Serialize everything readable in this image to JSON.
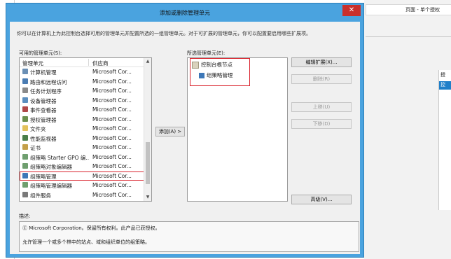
{
  "background": {
    "right_title": "页面 - 单个授权",
    "right_pane_header": "授",
    "right_pane_row": "控"
  },
  "dialog": {
    "title": "添加或删除管理单元",
    "close_glyph": "✕",
    "description": "你可以在计算机上为此控制台选择可用的管理单元并配置所选的一组管理单元。对于可扩展的管理单元，你可以配置要启用哪些扩展项。",
    "available_label": "可用的管理单元(S):",
    "selected_label": "所选管理单元(E):",
    "columns": {
      "name": "管理单元",
      "vendor": "供应商"
    },
    "snapins": [
      {
        "name": "计算机管理",
        "vendor": "Microsoft Cor...",
        "icon": "#6a8fb5"
      },
      {
        "name": "路由和远程访问",
        "vendor": "Microsoft Cor...",
        "icon": "#4b7db3"
      },
      {
        "name": "任务计划程序",
        "vendor": "Microsoft Cor...",
        "icon": "#8a8a8a"
      },
      {
        "name": "设备管理器",
        "vendor": "Microsoft Cor...",
        "icon": "#5b8fbf"
      },
      {
        "name": "事件查看器",
        "vendor": "Microsoft Cor...",
        "icon": "#b04848"
      },
      {
        "name": "授权管理器",
        "vendor": "Microsoft Cor...",
        "icon": "#6b8f4d"
      },
      {
        "name": "文件夹",
        "vendor": "Microsoft Cor...",
        "icon": "#e3c25c"
      },
      {
        "name": "性能监视器",
        "vendor": "Microsoft Cor...",
        "icon": "#4a7f4a"
      },
      {
        "name": "证书",
        "vendor": "Microsoft Cor...",
        "icon": "#c4a04a"
      },
      {
        "name": "组策略 Starter GPO 编...",
        "vendor": "Microsoft Cor...",
        "icon": "#6f9f6f"
      },
      {
        "name": "组策略对象编辑器",
        "vendor": "Microsoft Cor...",
        "icon": "#6f9f6f"
      },
      {
        "name": "组策略管理",
        "vendor": "Microsoft Cor...",
        "icon": "#3d78b8"
      },
      {
        "name": "组策略管理编辑器",
        "vendor": "Microsoft Cor...",
        "icon": "#6f9f6f"
      },
      {
        "name": "组件服务",
        "vendor": "Microsoft Cor...",
        "icon": "#7a7a7a"
      }
    ],
    "selected_index": 11,
    "add_button": "添加(A) >",
    "tree": {
      "root": "控制台根节点",
      "child": "组策略管理"
    },
    "buttons": {
      "edit_extensions": "编辑扩展(X)...",
      "remove": "删除(R)",
      "move_up": "上移(U)",
      "move_down": "下移(D)",
      "advanced": "高级(V)..."
    },
    "desc_label": "描述:",
    "desc_line1": "Ⓒ Microsoft Corporation。保留所有权利。此产品已获授权。",
    "desc_line2": "允许管理一个或多个林中的站点、域和组织单位的组策略。"
  }
}
